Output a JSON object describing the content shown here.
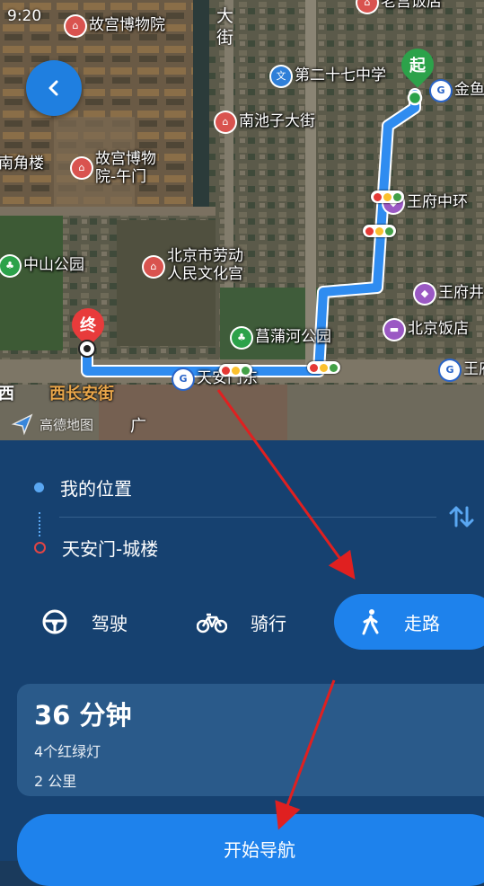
{
  "status_bar": {
    "time": "9:20"
  },
  "map": {
    "pois": [
      {
        "id": "gugong",
        "label": "故宫博物院",
        "icon": "museum-icon",
        "color": "red"
      },
      {
        "id": "laogong",
        "label": "老宫饭店",
        "icon": "hotel-icon",
        "color": "red"
      },
      {
        "id": "school",
        "label": "第二十七中学",
        "icon": "school-icon",
        "color": "blue"
      },
      {
        "id": "nanchizi",
        "label": "南池子大街",
        "icon": "landmark-icon",
        "color": "red"
      },
      {
        "id": "jinyu",
        "label": "金鱼",
        "icon": "metro-icon",
        "color": "metro"
      },
      {
        "id": "nanjiaolou",
        "label": "南角楼",
        "icon": "none",
        "color": "none"
      },
      {
        "id": "wumen",
        "label": "故宫博物\n院-午门",
        "icon": "museum-icon",
        "color": "red"
      },
      {
        "id": "wangfu_zhonghuan",
        "label": "王府中环",
        "icon": "shopping-icon",
        "color": "purple"
      },
      {
        "id": "laodong",
        "label": "北京市劳动\n人民文化宫",
        "icon": "museum-icon",
        "color": "red"
      },
      {
        "id": "zhongshan",
        "label": "中山公园",
        "icon": "park-icon",
        "color": "green"
      },
      {
        "id": "wangfujing",
        "label": "王府井",
        "icon": "shopping-icon",
        "color": "purple"
      },
      {
        "id": "beijing_hotel",
        "label": "北京饭店",
        "icon": "hotel-icon",
        "color": "purple"
      },
      {
        "id": "changpu",
        "label": "菖蒲河公园",
        "icon": "park-icon",
        "color": "green"
      },
      {
        "id": "tiananmen_east",
        "label": "天安门东",
        "icon": "metro-icon",
        "color": "metro"
      },
      {
        "id": "wang_right",
        "label": "王府",
        "icon": "metro-icon",
        "color": "metro"
      }
    ],
    "street_dajie": "大街",
    "street_changan": "西长安街",
    "edge_xi": "西",
    "edge_guang": "广",
    "start_label": "起",
    "end_label": "终",
    "logo_text": "高德地图",
    "route_color": "#2f8cf0"
  },
  "route_input": {
    "from": "我的位置",
    "to": "天安门-城楼"
  },
  "modes": {
    "drive": "驾驶",
    "bike": "骑行",
    "walk": "走路",
    "selected": "walk"
  },
  "route_summary": {
    "time": "36 分钟",
    "traffic_lights": "4个红绿灯",
    "distance": "2 公里"
  },
  "start_button": "开始导航",
  "colors": {
    "accent": "#1e82ec",
    "panel": "#164170",
    "card": "#2a5a8a",
    "annotation_arrow": "#e02020"
  }
}
